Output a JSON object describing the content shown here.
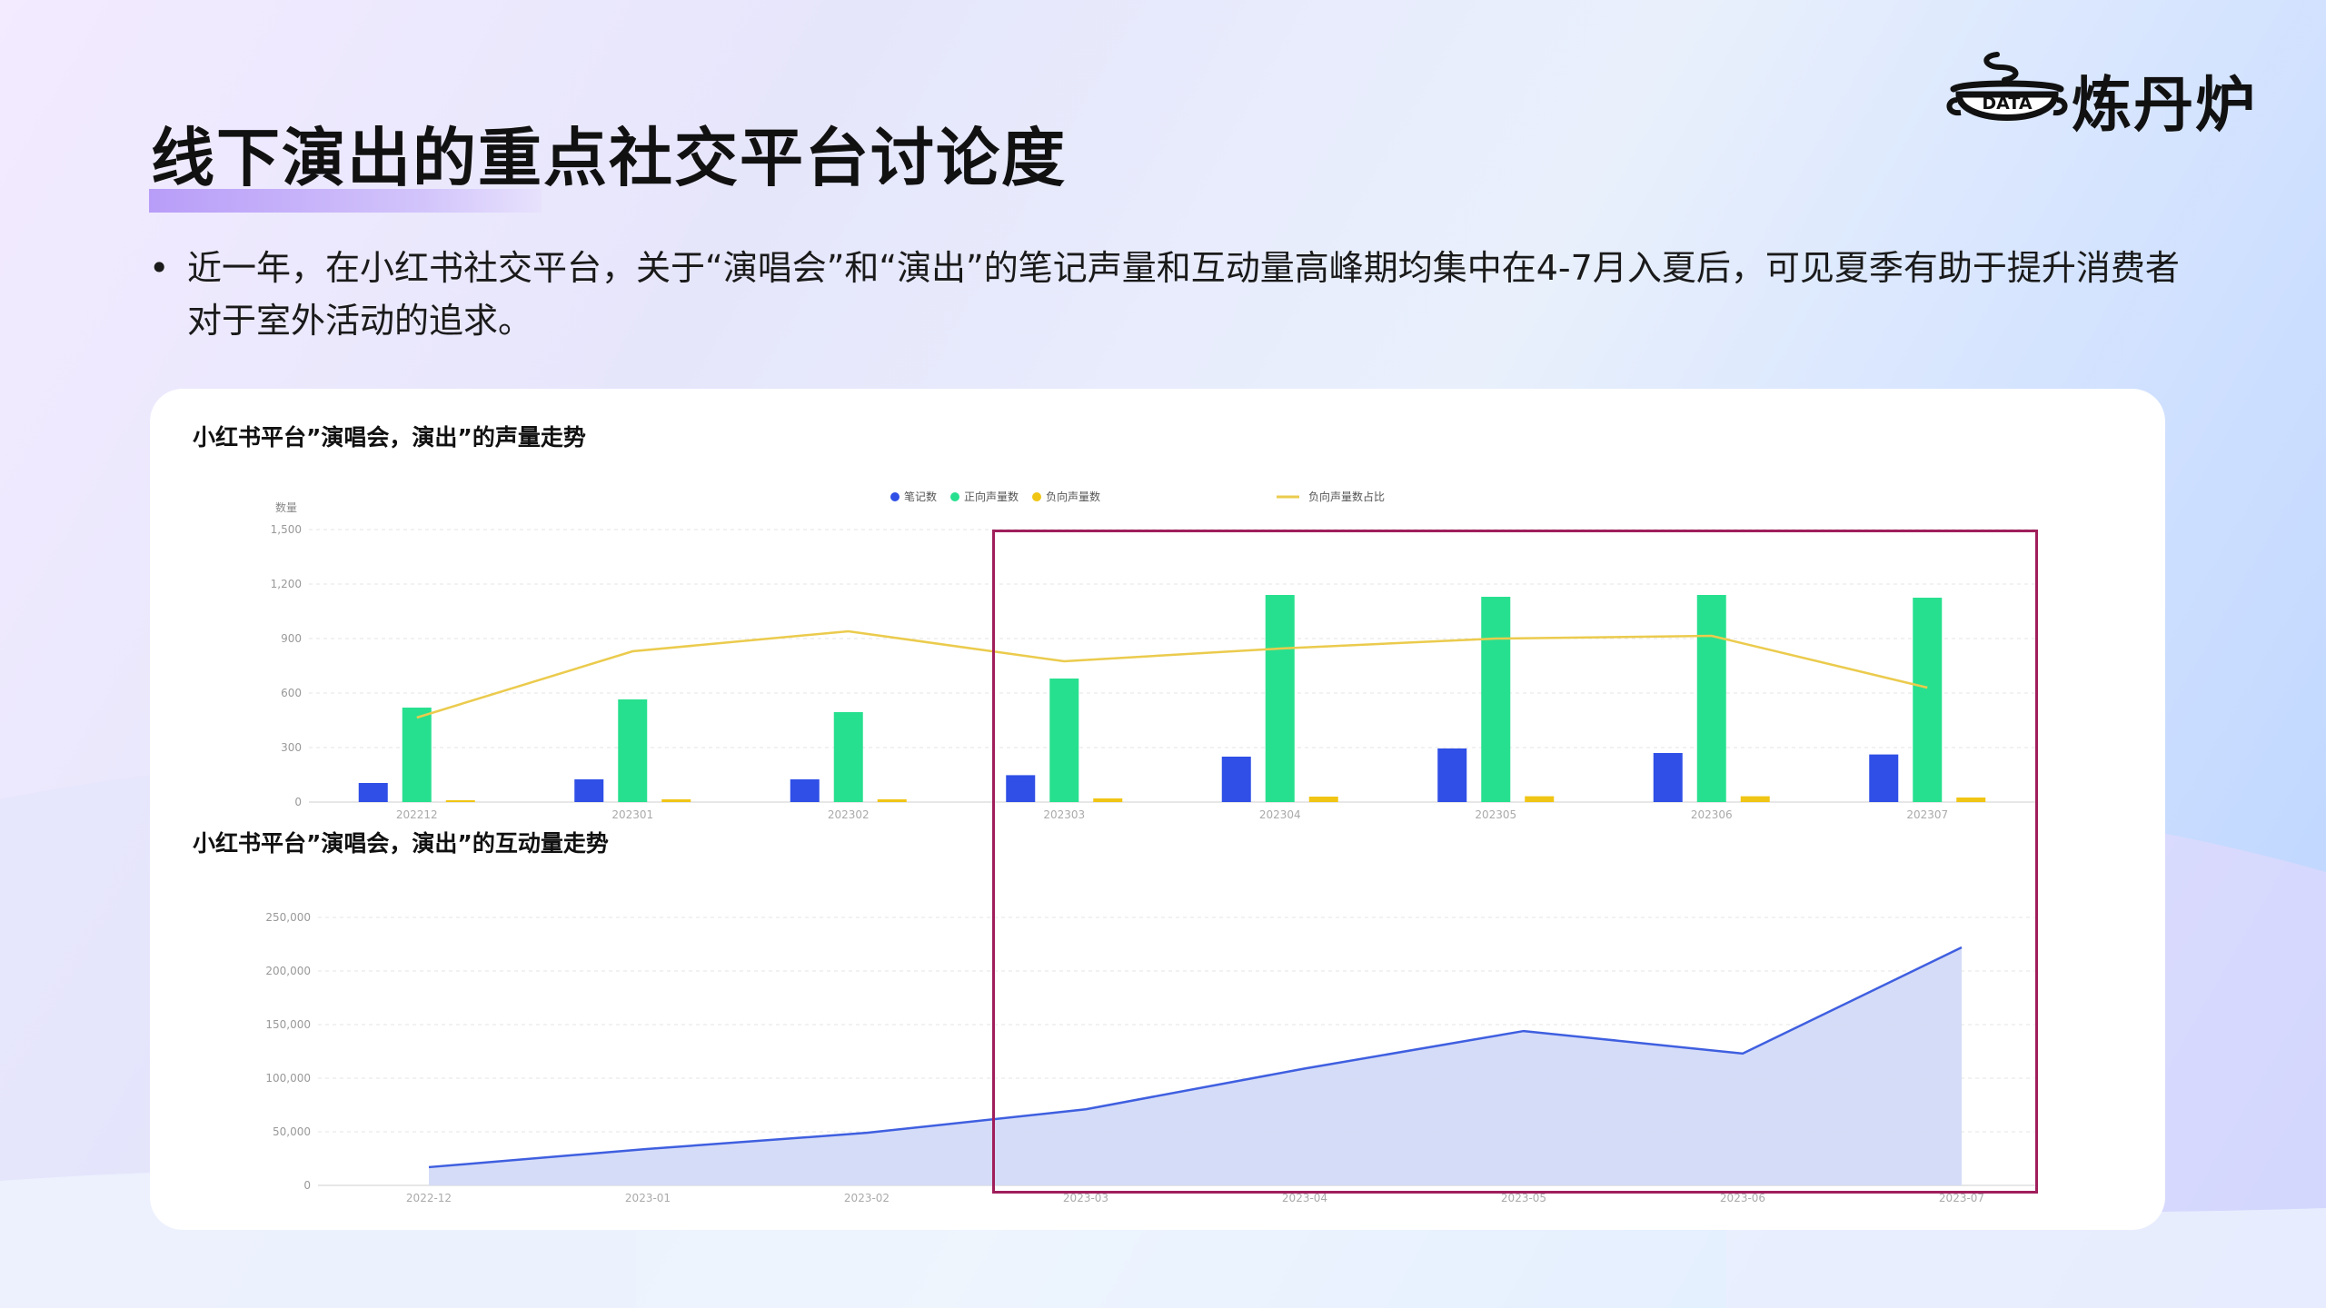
{
  "page": {
    "title": "线下演出的重点社交平台讨论度",
    "bullet": "近一年，在小红书社交平台，关于“演唱会”和“演出”的笔记声量和互动量高峰期均集中在4-7月入夏后，可见夏季有助于提升消费者对于室外活动的追求。",
    "bullet_marker": "•"
  },
  "logo": {
    "badge_text": "DATA",
    "name": "炼丹炉"
  },
  "colors": {
    "notes": "#2f4fe6",
    "positive": "#27e08f",
    "negative": "#f0c514",
    "negative_ratio_line": "#ebcb4d",
    "interaction_line": "#3f5fe0",
    "interaction_fill": "#d3daf7",
    "highlight_box": "#a01f5b",
    "title_underline": "#b89df8"
  },
  "chart_data": [
    {
      "type": "bar",
      "title": "小红书平台”演唱会，演出”的声量走势",
      "ylabel": "数量",
      "ylim": [
        0,
        1500
      ],
      "yticks": [
        "0",
        "300",
        "600",
        "900",
        "1,200",
        "1,500"
      ],
      "categories": [
        "202212",
        "202301",
        "202302",
        "202303",
        "202304",
        "202305",
        "202306",
        "202307"
      ],
      "series": [
        {
          "name": "笔记数",
          "kind": "bar",
          "values": [
            105,
            125,
            125,
            148,
            250,
            295,
            270,
            262
          ]
        },
        {
          "name": "正向声量数",
          "kind": "bar",
          "values": [
            520,
            565,
            495,
            680,
            1140,
            1130,
            1140,
            1125
          ]
        },
        {
          "name": "负向声量数",
          "kind": "bar",
          "values": [
            10,
            15,
            15,
            20,
            30,
            32,
            32,
            25
          ]
        },
        {
          "name": "负向声量数占比",
          "kind": "line",
          "values": [
            465,
            830,
            940,
            775,
            845,
            900,
            915,
            630
          ]
        }
      ],
      "legend_position": "top-center",
      "grid": true
    },
    {
      "type": "area",
      "title": "小红书平台”演唱会，演出”的互动量走势",
      "ylim": [
        0,
        250000
      ],
      "yticks": [
        "0",
        "50,000",
        "100,000",
        "150,000",
        "200,000",
        "250,000"
      ],
      "categories": [
        "2022-12",
        "2023-01",
        "2023-02",
        "2023-03",
        "2023-04",
        "2023-05",
        "2023-06",
        "2023-07"
      ],
      "series": [
        {
          "name": "",
          "values": [
            17000,
            34000,
            49000,
            71000,
            109000,
            144000,
            123000,
            222000
          ]
        }
      ],
      "grid": true
    }
  ]
}
